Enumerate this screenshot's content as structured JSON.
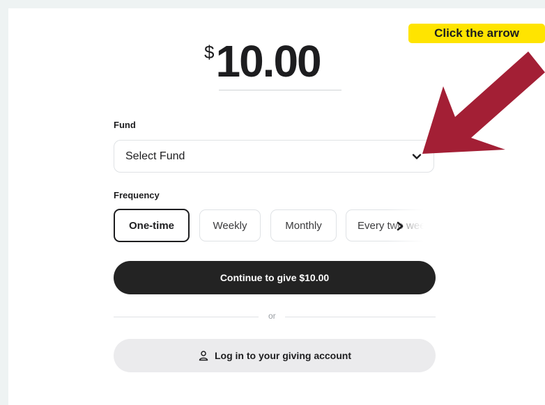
{
  "amount": {
    "currency": "$",
    "value": "10.00"
  },
  "fund": {
    "label": "Fund",
    "placeholder": "Select Fund",
    "chevron_icon": "chevron-down-icon"
  },
  "frequency": {
    "label": "Frequency",
    "options": [
      "One-time",
      "Weekly",
      "Monthly",
      "Every two wee"
    ],
    "selected": "One-time",
    "scroll_icon": "chevron-right-icon"
  },
  "buttons": {
    "continue": "Continue to give $10.00",
    "or": "or",
    "login": "Log in to your giving account",
    "login_icon": "user-icon"
  },
  "annotation": {
    "callout": "Click the arrow",
    "callout_color": "#ffe400",
    "arrow_color": "#a31f35"
  }
}
